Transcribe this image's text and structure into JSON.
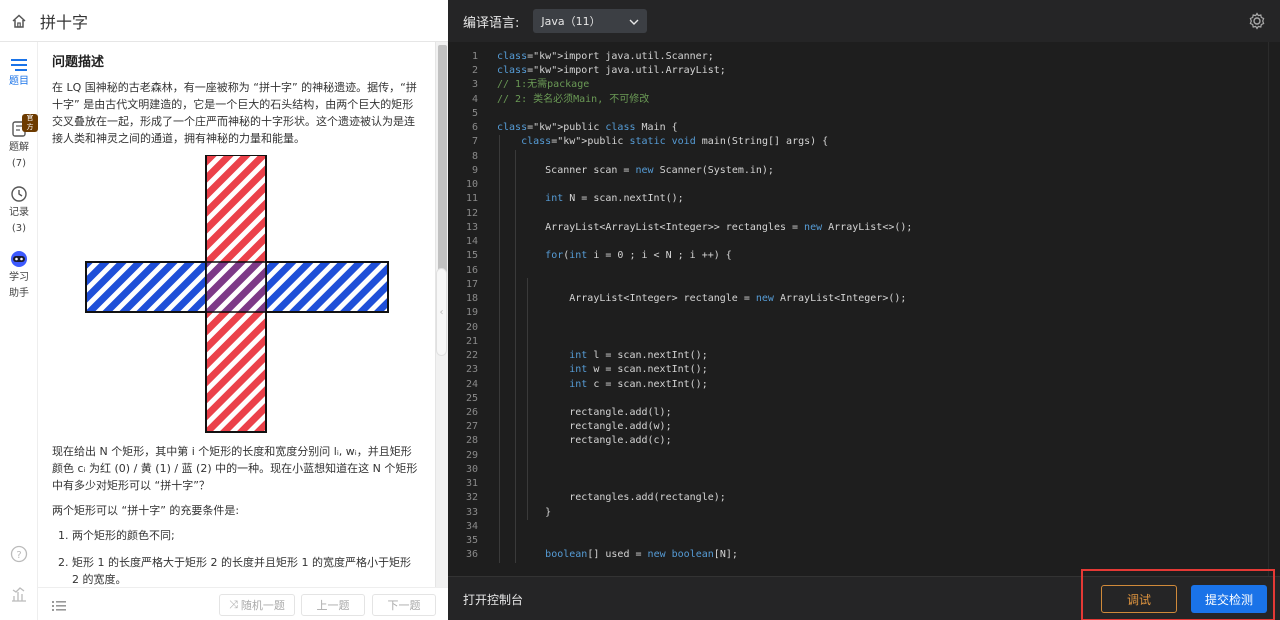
{
  "header": {
    "title": "拼十字"
  },
  "rail": {
    "items": [
      {
        "label": "题目",
        "icon": "list-icon",
        "active": true
      },
      {
        "label": "题解",
        "badge": "官方",
        "count": "(7)",
        "icon": "solution-icon"
      },
      {
        "label": "记录",
        "count": "(3)",
        "icon": "history-icon"
      },
      {
        "label": "学习",
        "label2": "助手",
        "icon": "assistant-icon"
      }
    ]
  },
  "problem": {
    "heading": "问题描述",
    "intro": "在 LQ 国神秘的古老森林，有一座被称为 “拼十字” 的神秘遗迹。据传，“拼十字” 是由古代文明建造的，它是一个巨大的石头结构，由两个巨大的矩形交叉叠放在一起，形成了一个庄严而神秘的十字形状。这个遗迹被认为是连接人类和神灵之间的通道，拥有神秘的力量和能量。",
    "para2": "现在给出 N 个矩形，其中第 i 个矩形的长度和宽度分别问 lᵢ, wᵢ，并且矩形颜色 cᵢ 为红 (0) / 黄 (1) / 蓝 (2) 中的一种。现在小蓝想知道在这 N 个矩形中有多少对矩形可以 “拼十字”？",
    "para3": "两个矩形可以 “拼十字” 的充要条件是:",
    "conditions": [
      "两个矩形的颜色不同;",
      "矩形 1 的长度严格大于矩形 2 的长度并且矩形 1 的宽度严格小于矩形 2 的宽度。"
    ]
  },
  "bottom_left": {
    "random": "随机一题",
    "prev": "上一题",
    "next": "下一题"
  },
  "editor": {
    "lang_label": "编译语言:",
    "lang_value": "Java（11）",
    "console": "打开控制台",
    "debug": "调试",
    "submit": "提交检测",
    "lines": [
      "import java.util.Scanner;",
      "import java.util.ArrayList;",
      "// 1:无需package",
      "// 2: 类名必须Main, 不可修改",
      "",
      "public class Main {",
      "    public static void main(String[] args) {",
      "",
      "        Scanner scan = new Scanner(System.in);",
      "",
      "        int N = scan.nextInt();",
      "",
      "        ArrayList<ArrayList<Integer>> rectangles = new ArrayList<>();",
      "",
      "        for(int i = 0 ; i < N ; i ++) {",
      "",
      "",
      "            ArrayList<Integer> rectangle = new ArrayList<Integer>();",
      "",
      "",
      "",
      "            int l = scan.nextInt();",
      "            int w = scan.nextInt();",
      "            int c = scan.nextInt();",
      "",
      "            rectangle.add(l);",
      "            rectangle.add(w);",
      "            rectangle.add(c);",
      "",
      "",
      "",
      "            rectangles.add(rectangle);",
      "        }",
      "",
      "",
      "        boolean[] used = new boolean[N];"
    ]
  },
  "colors": {
    "accent": "#1a73e8",
    "red": "#e8202a",
    "blue": "#1f4fd8",
    "debug": "#e0953f",
    "highlight": "#e53935"
  }
}
